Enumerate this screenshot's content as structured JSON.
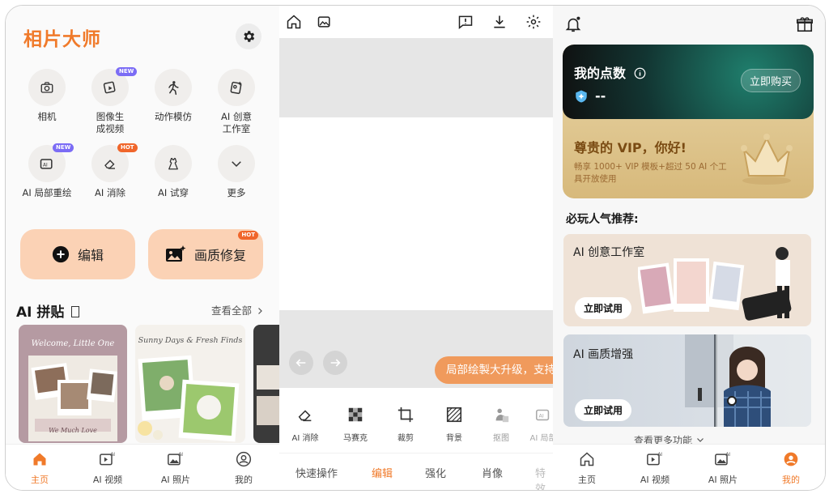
{
  "home": {
    "brand": "相片大师",
    "tools": [
      {
        "label": "相机",
        "icon": "camera-icon",
        "badge": ""
      },
      {
        "label": "图像生\n成视频",
        "icon": "image-to-video-icon",
        "badge": "NEW"
      },
      {
        "label": "动作模仿",
        "icon": "motion-imitate-icon",
        "badge": ""
      },
      {
        "label": "AI 创意\n工作室",
        "icon": "ai-studio-icon",
        "badge": ""
      },
      {
        "label": "AI 局部重绘",
        "icon": "ai-inpaint-icon",
        "badge": "NEW"
      },
      {
        "label": "AI 消除",
        "icon": "eraser-icon",
        "badge": "HOT"
      },
      {
        "label": "AI 试穿",
        "icon": "dress-icon",
        "badge": ""
      },
      {
        "label": "更多",
        "icon": "chevron-down-icon",
        "badge": ""
      }
    ],
    "edit_button": "编辑",
    "enhance_button": "画质修复",
    "enhance_badge": "HOT",
    "collage_title": "AI 拼贴",
    "see_all": "查看全部",
    "card1_title": "Welcome, Little One",
    "card1_sub": "We Much Love",
    "card2_title": "Sunny Days & Fresh Finds",
    "tabs": [
      "主页",
      "AI 视频",
      "AI 照片",
      "我的"
    ],
    "accent": "#f07a2a"
  },
  "editor": {
    "tip": "局部绘製大升级，支持",
    "tools": [
      "AI 消除",
      "马赛克",
      "裁剪",
      "背景",
      "抠图",
      "AI 局部"
    ],
    "modes": [
      "快速操作",
      "编辑",
      "强化",
      "肖像",
      "特效"
    ],
    "active_mode": "编辑"
  },
  "profile": {
    "points_title": "我的点数",
    "points_value": "--",
    "buy_button": "立即购买",
    "vip_greeting": "尊贵的 VIP，你好!",
    "vip_desc": "畅享 1000+ VIP 模板+超过 50 AI 个工具开放使用",
    "reco_title": "必玩人气推荐:",
    "card1_title": "AI 创意工作室",
    "card2_title": "AI 画质增强",
    "try_button": "立即试用",
    "more_features": "查看更多功能",
    "tabs": [
      "主页",
      "AI 视频",
      "AI 照片",
      "我的"
    ]
  }
}
